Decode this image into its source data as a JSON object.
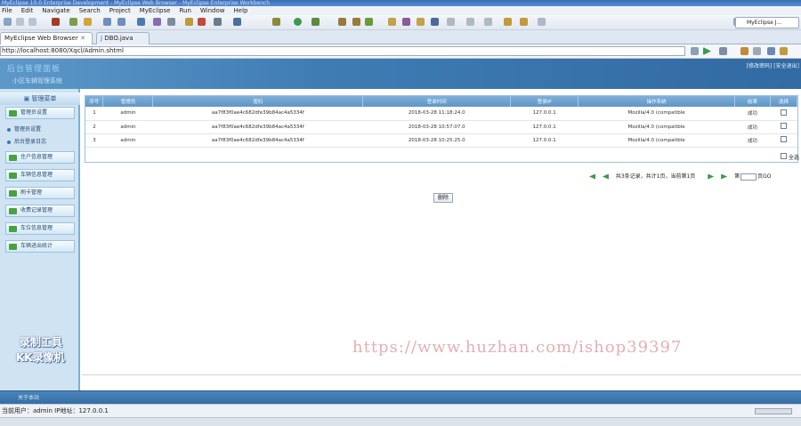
{
  "window": {
    "title": "MyEclipse 10.0 Enterprise Development - MyEclipse Web Browser - MyEclipse Enterprise Workbench"
  },
  "menu": [
    "File",
    "Edit",
    "Navigate",
    "Search",
    "Project",
    "MyEclipse",
    "Run",
    "Window",
    "Help"
  ],
  "perspective": {
    "label": "MyEclipse J..."
  },
  "tabs": [
    {
      "label": "MyEclipse Web Browser",
      "active": true
    },
    {
      "label": "DBO.java",
      "active": false
    }
  ],
  "address": {
    "url": "http://localhost:8080/Xqcl/Admin.shtml"
  },
  "banner": {
    "title": "后台管理面板",
    "subtitle": "小区车辆管理系统",
    "links": "[修改密码] [安全退出]"
  },
  "sidebar": {
    "header": "管理菜单",
    "menus": [
      {
        "label": "管理员设置"
      },
      {
        "label": "住户信息管理"
      },
      {
        "label": "车辆信息管理"
      },
      {
        "label": "刷卡管理"
      },
      {
        "label": "收费记录管理"
      },
      {
        "label": "车位信息管理"
      },
      {
        "label": "车辆进出统计"
      }
    ],
    "subitems": [
      {
        "label": "管理员设置"
      },
      {
        "label": "后台登录日志"
      }
    ]
  },
  "watermarks": {
    "tool_line1": "录制工具",
    "tool_line2": "KK录像机",
    "site": "https://www.huzhan.com/ishop39397"
  },
  "grid": {
    "headers": [
      "序号",
      "管理员",
      "密码",
      "登录时间",
      "登录IP",
      "操作系统",
      "结果",
      "选择"
    ],
    "rows": [
      [
        "1",
        "admin",
        "aa7f83f0ae4c682dfe39b84ac4a5334f",
        "2018-03-28 11:18:24.0",
        "127.0.0.1",
        "Mozilla/4.0 (compatible",
        "成功"
      ],
      [
        "2",
        "admin",
        "aa7f83f0ae4c682dfe39b84ac4a5334f",
        "2018-03-28 10:57:07.0",
        "127.0.0.1",
        "Mozilla/4.0 (compatible",
        "成功"
      ],
      [
        "3",
        "admin",
        "aa7f83f0ae4c682dfe39b84ac4a5334f",
        "2018-03-28 10:25:25.0",
        "127.0.0.1",
        "Mozilla/4.0 (compatible",
        "成功"
      ]
    ],
    "select_all": "全选"
  },
  "pager": {
    "summary": "共3条记录，共计1页，当前第1页",
    "go_prefix": "第",
    "go_suffix": "页GO"
  },
  "actions": {
    "delete": "删除"
  },
  "footer": {
    "about": "关于本站"
  },
  "status": {
    "text": "当前用户：admin  IP地址：127.0.0.1"
  },
  "colors": {
    "banner": "#3f7cb4",
    "header_row": "#6fa3cf",
    "sidebar": "#cfe3f2"
  }
}
